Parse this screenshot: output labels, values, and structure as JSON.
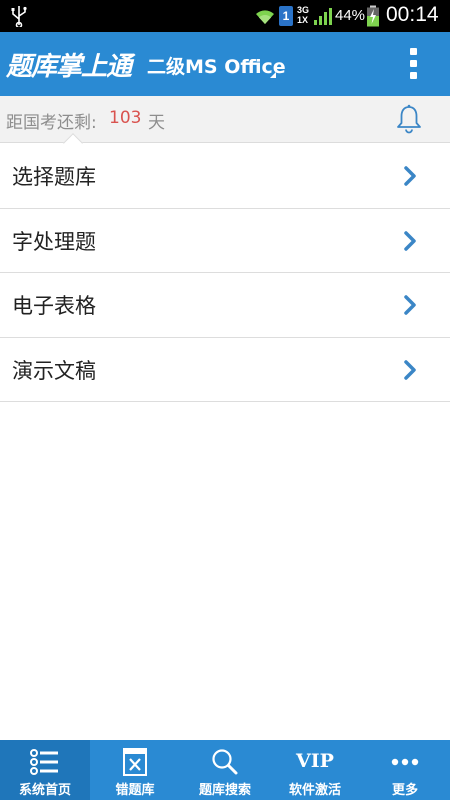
{
  "status_bar": {
    "usb_icon": "usb-icon",
    "wifi_icon": "wifi-icon",
    "sim_slot": "1",
    "network_type_top": "3G",
    "network_type_bottom": "1X",
    "battery_percent": "44%",
    "time": "00:14"
  },
  "header": {
    "app_logo": "题库掌上通",
    "subject": "二级MS Office",
    "overflow_icon": "overflow-menu-icon"
  },
  "countdown": {
    "label": "距国考还剩:",
    "days": "103",
    "unit": "天",
    "bell_icon": "bell-icon"
  },
  "menu": {
    "items": [
      {
        "label": "选择题库"
      },
      {
        "label": "字处理题"
      },
      {
        "label": "电子表格"
      },
      {
        "label": "演示文稿"
      }
    ]
  },
  "tabs": [
    {
      "label": "系统首页",
      "icon": "home-list-icon",
      "active": true
    },
    {
      "label": "错题库",
      "icon": "wrong-questions-icon",
      "active": false
    },
    {
      "label": "题库搜索",
      "icon": "search-icon",
      "active": false
    },
    {
      "label": "软件激活",
      "badge_text": "VIP",
      "active": false
    },
    {
      "label": "更多",
      "icon": "more-icon",
      "active": false
    }
  ],
  "colors": {
    "primary": "#2a8ad3",
    "accent_days": "#d9534f",
    "chevron": "#3b86c6"
  }
}
